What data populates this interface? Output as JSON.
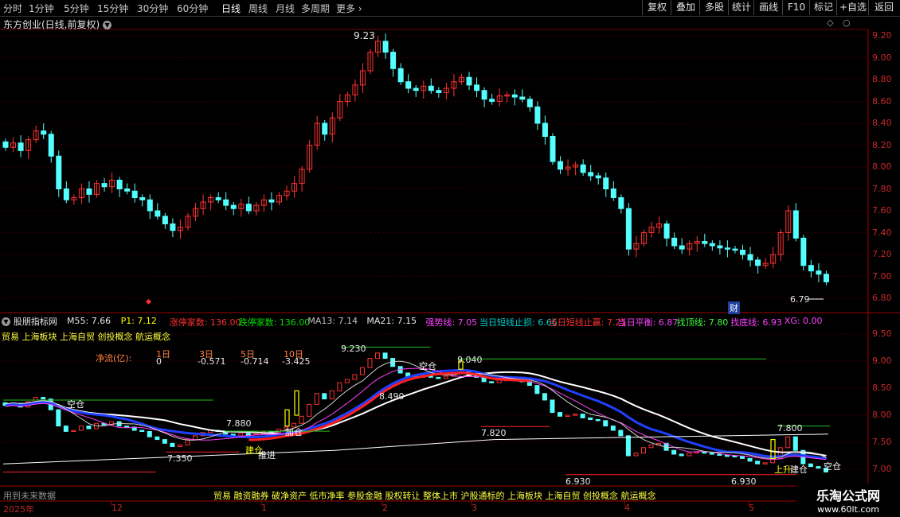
{
  "toolbar": {
    "periods": [
      "分时",
      "1分钟",
      "5分钟",
      "15分钟",
      "30分钟",
      "60分钟",
      "日线",
      "周线",
      "月线",
      "多周期",
      "更多"
    ],
    "active_period": "日线",
    "right_buttons": [
      "复权",
      "叠加",
      "多股",
      "统计",
      "画线",
      "F10",
      "标记",
      "+自选",
      "返回"
    ]
  },
  "stock": {
    "title": "东方创业(日线,前复权)"
  },
  "price_axis": [
    "9.20",
    "9.00",
    "8.80",
    "8.60",
    "8.40",
    "8.20",
    "8.00",
    "7.80",
    "7.60",
    "7.40",
    "7.20",
    "7.00",
    "6.80"
  ],
  "price_annotations": {
    "high": "9.23",
    "low": "6.79",
    "fin_badge": "财"
  },
  "indicator": {
    "name": "股朋指标网",
    "items": [
      {
        "label": "M55: 7.66",
        "color": "#e8e8e8"
      },
      {
        "label": "P1: 7.12",
        "color": "#ffff00"
      },
      {
        "label": "涨停家数: 136.00",
        "color": "#ff3030"
      },
      {
        "label": "跌停家数: 136.00",
        "color": "#00e000"
      },
      {
        "label": "MA13: 7.14",
        "color": "#c0c0c0"
      },
      {
        "label": "MA21: 7.15",
        "color": "#e8e8e8"
      },
      {
        "label": "强势线: 7.05",
        "color": "#ff40ff"
      },
      {
        "label": "当日短线止损: 6.66",
        "color": "#00d0d0"
      },
      {
        "label": "当日短线止赢: 7.21",
        "color": "#ff3030"
      },
      {
        "label": "当日平衡: 6.87",
        "color": "#ff40ff"
      },
      {
        "label": "找顶线: 7.80",
        "color": "#40ff40"
      },
      {
        "label": "找底线: 6.93",
        "color": "#ff40ff"
      },
      {
        "label": "XG: 0.00",
        "color": "#ff40ff"
      }
    ],
    "concepts": "贸易 上海板块 上海自贸 创投概念 航运概念",
    "bottom_concepts": "贸易 融资融券 破净资产 低市净率 参股金融 股权转让 整体上市 沪股通标的 上海板块 上海自贸 创投概念 航运概念"
  },
  "netflow": {
    "label": "净流(亿):",
    "headers": [
      "1日",
      "3日",
      "5日",
      "10日"
    ],
    "values": [
      "0",
      "-0.571",
      "-0.714",
      "-3.425"
    ]
  },
  "ind_axis": [
    "9.50",
    "9.00",
    "8.50",
    "8.00",
    "7.50",
    "7.00"
  ],
  "ind_annotations": {
    "v9230": "9.230",
    "v9040": "9.040",
    "v8490": "8.490",
    "v7880": "7.880",
    "v7820": "7.820",
    "v7350": "7.350",
    "v6930a": "6.930",
    "v6930b": "6.930",
    "v7800": "7.800",
    "kc1": "空仓",
    "kc2": "空仓",
    "kc3": "空仓",
    "jc1": "建仓",
    "jc2": "推进",
    "jc3": "加仓",
    "jc4": "上升",
    "jc5": "建仓"
  },
  "time_axis": [
    "2025年",
    "12",
    "1",
    "2",
    "3",
    "4",
    "5"
  ],
  "watermark": {
    "text": "乐淘公式网",
    "url": "www.60lt.com"
  },
  "future_data": "用到未来数据",
  "colors": {
    "up": "#ff3232",
    "down": "#54ffff",
    "grid": "#7a0000"
  }
}
